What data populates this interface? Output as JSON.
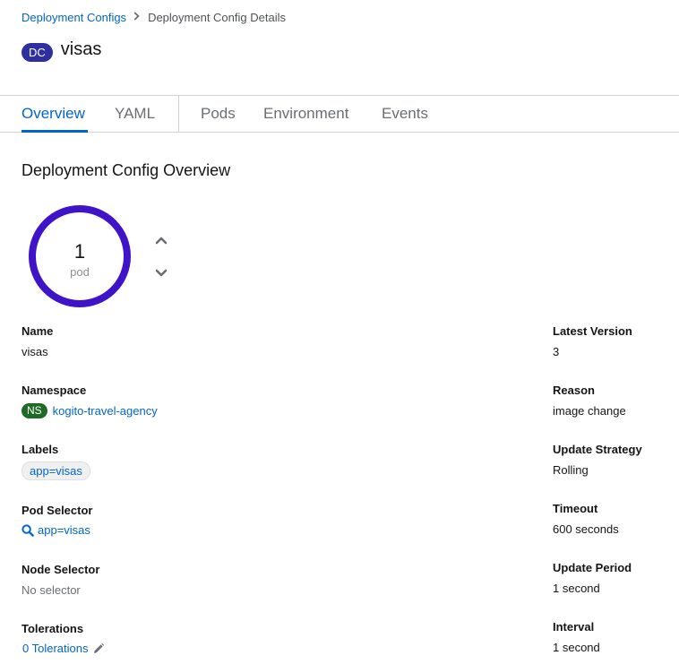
{
  "breadcrumb": {
    "parent": "Deployment Configs",
    "current": "Deployment Config Details"
  },
  "header": {
    "badge": "DC",
    "title": "visas"
  },
  "tabs": [
    {
      "label": "Overview",
      "active": true
    },
    {
      "label": "YAML",
      "active": false
    },
    {
      "label": "Pods",
      "active": false
    },
    {
      "label": "Environment",
      "active": false
    },
    {
      "label": "Events",
      "active": false
    }
  ],
  "overview": {
    "section_title": "Deployment Config Overview",
    "pods": {
      "count": "1",
      "label": "pod",
      "ring_color": "#3f14c8"
    },
    "left": {
      "name_label": "Name",
      "name_value": "visas",
      "namespace_label": "Namespace",
      "namespace_badge": "NS",
      "namespace_value": "kogito-travel-agency",
      "labels_label": "Labels",
      "labels_chip": "app=visas",
      "pod_selector_label": "Pod Selector",
      "pod_selector_value": "app=visas",
      "node_selector_label": "Node Selector",
      "node_selector_value": "No selector",
      "tolerations_label": "Tolerations",
      "tolerations_value": "0 Tolerations"
    },
    "right": {
      "latest_version_label": "Latest Version",
      "latest_version_value": "3",
      "reason_label": "Reason",
      "reason_value": "image change",
      "update_strategy_label": "Update Strategy",
      "update_strategy_value": "Rolling",
      "timeout_label": "Timeout",
      "timeout_value": "600 seconds",
      "update_period_label": "Update Period",
      "update_period_value": "1 second",
      "interval_label": "Interval",
      "interval_value": "1 second"
    }
  },
  "icons": {
    "breadcrumb_separator": "chevron-right-icon",
    "scale_up": "chevron-up-icon",
    "scale_down": "chevron-down-icon",
    "pod_selector": "search-icon",
    "tolerations_edit": "pencil-icon"
  },
  "colors": {
    "link": "#0066cc",
    "dc_badge": "#2f2fa0",
    "ns_badge": "#1e6b26"
  }
}
